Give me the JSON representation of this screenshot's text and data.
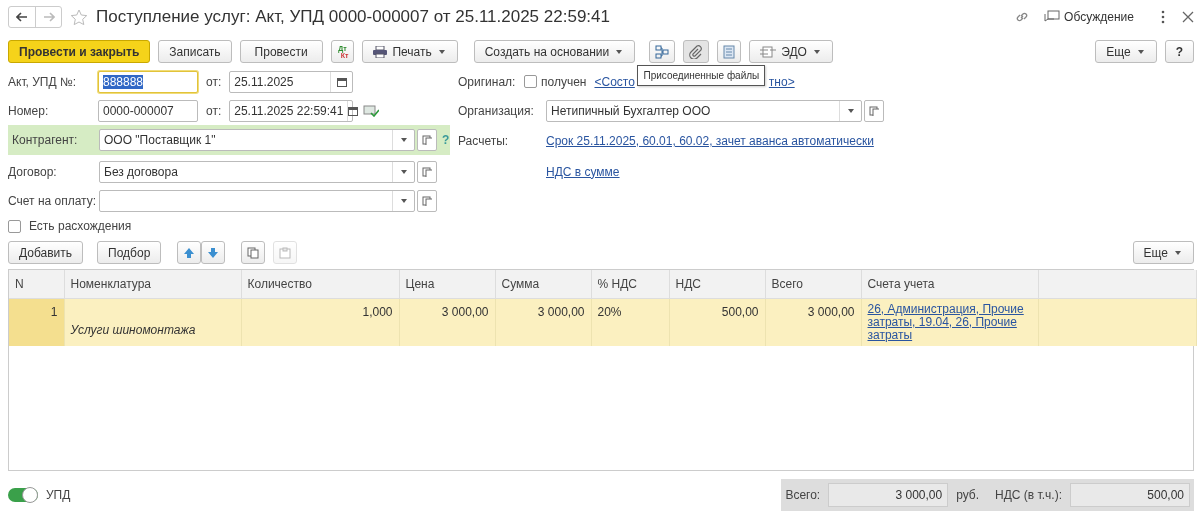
{
  "window": {
    "title": "Поступление услуг: Акт, УПД 0000-000007 от 25.11.2025 22:59:41",
    "favorite": false,
    "discussion": "Обсуждение"
  },
  "toolbar": {
    "buttons": [
      {
        "kind": "primary",
        "label": "Провести и закрыть"
      },
      {
        "kind": "text",
        "label": "Записать"
      },
      {
        "kind": "text",
        "label": "Провести"
      },
      {
        "kind": "dtkt",
        "label": "Дт",
        "label2": "Кт"
      },
      {
        "kind": "print",
        "label": "Печать"
      },
      {
        "kind": "menu",
        "label": "Создать на основании"
      },
      {
        "kind": "structure"
      },
      {
        "kind": "clip",
        "pressed": true
      },
      {
        "kind": "list"
      },
      {
        "kind": "edo",
        "label": "ЭДО"
      }
    ],
    "more": "Еще",
    "help": "?"
  },
  "tooltip": "Присоединенные файлы",
  "left_fields": [
    {
      "kind": "text",
      "label": "Акт, УПД №:",
      "value": "888888",
      "focused": true,
      "date_label": "от:",
      "date": "25.11.2025"
    },
    {
      "kind": "text",
      "label": "Номер:",
      "value": "0000-000007",
      "focused": false,
      "date_label": "от:",
      "date": "25.11.2025 22:59:41"
    },
    {
      "kind": "select",
      "label": "Контрагент:",
      "value": "ООО \"Поставщик 1\"",
      "highlight": true,
      "hint": "?"
    },
    {
      "kind": "select",
      "label": "Договор:",
      "value": "Без договора",
      "highlight": false
    },
    {
      "kind": "select",
      "label": "Счет на оплату:",
      "highlight": false
    }
  ],
  "original": {
    "label": "Оригинал:",
    "checkbox_label": "получен",
    "checked": false,
    "link_parts": [
      "<Состо",
      "тно>"
    ]
  },
  "organization": {
    "label": "Организация:",
    "value": "Нетипичный Бухгалтер ООО"
  },
  "settlements": {
    "label": "Расчеты:",
    "link": "Срок 25.11.2025, 60.01, 60.02, зачет аванса автоматически"
  },
  "vat_link": "НДС в сумме",
  "discrepancies": {
    "label": "Есть расхождения",
    "checked": false
  },
  "table_toolbar": {
    "add": "Добавить",
    "pick": "Подбор",
    "copy_disabled": false,
    "paste_disabled": true,
    "more": "Еще"
  },
  "table": {
    "columns": [
      "N",
      "Номенклатура",
      "Количество",
      "Цена",
      "Сумма",
      "% НДС",
      "НДС",
      "Всего",
      "Счета учета"
    ],
    "rows": [
      {
        "selected": true,
        "n": "1",
        "item": "Услуги шиномонтажа",
        "qty": "1,000",
        "price": "3 000,00",
        "sum": "3 000,00",
        "vat_rate": "20%",
        "vat": "500,00",
        "total": "3 000,00",
        "accounts": "26, Администрация, Прочие затраты, 19.04, 26, Прочие затраты"
      }
    ]
  },
  "footer": {
    "toggle_label": "УПД",
    "toggle_on": true,
    "total_label": "Всего:",
    "total": "3 000,00",
    "currency": "руб.",
    "vat_label": "НДС (в т.ч.):",
    "vat": "500,00"
  }
}
